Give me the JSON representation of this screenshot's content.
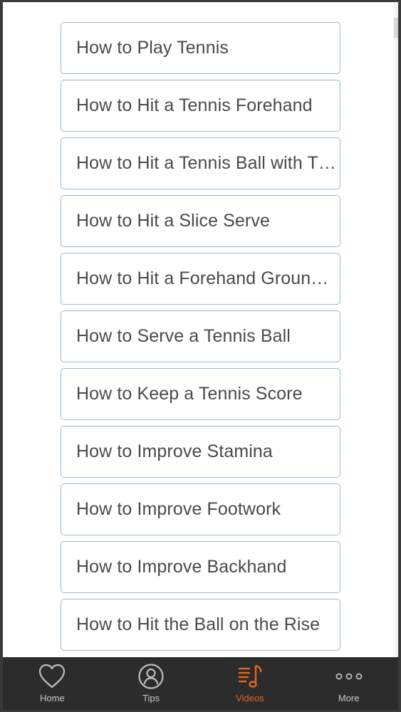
{
  "videos": {
    "items": [
      "How to Play Tennis",
      "How to Hit a Tennis Forehand",
      "How to Hit a Tennis Ball with T…",
      "How to Hit a Slice Serve",
      "How to Hit a Forehand Ground …",
      "How to Serve a Tennis Ball",
      "How to Keep a Tennis Score",
      "How to Improve Stamina",
      "How to Improve Footwork",
      "How to Improve Backhand",
      "How to Hit the Ball on the Rise"
    ]
  },
  "tabbar": {
    "tabs": [
      {
        "label": "Home",
        "icon": "heart-icon"
      },
      {
        "label": "Tips",
        "icon": "user-icon"
      },
      {
        "label": "Videos",
        "icon": "playlist-icon",
        "active": true
      },
      {
        "label": "More",
        "icon": "more-dots-icon"
      }
    ]
  },
  "colors": {
    "accent": "#e06a1b",
    "tabbar_bg": "#2c2c2c",
    "item_border": "#9dbad0",
    "item_text": "#4a4a4a",
    "tab_icon": "#bdbdbd"
  }
}
